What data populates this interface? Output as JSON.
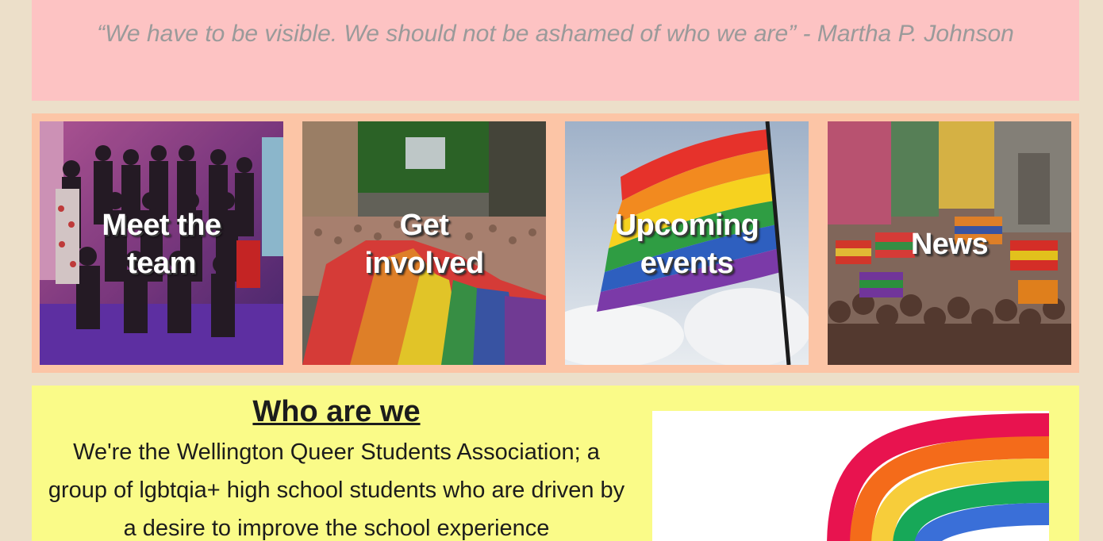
{
  "quote": {
    "text": "“We have to be visible. We should not be ashamed of who we are” - Martha P. Johnson"
  },
  "cards": [
    {
      "label_line1": "Meet the",
      "label_line2": "team"
    },
    {
      "label_line1": "Get",
      "label_line2": "involved"
    },
    {
      "label_line1": "Upcoming",
      "label_line2": "events"
    },
    {
      "label_line1": "News"
    }
  ],
  "about": {
    "title": "Who are we",
    "body": "We're the Wellington Queer Students Association; a group of lgbtqia+ high school students who are driven by a desire to improve the school experience"
  },
  "colors": {
    "page_background": "#ecdfc9",
    "quote_panel": "#fdc3c3",
    "cards_panel": "#fcc5a6",
    "about_panel": "#fafb88",
    "rainbow": [
      "#e8134f",
      "#f46b1a",
      "#f7cd3a",
      "#17a858",
      "#3a6fd8"
    ]
  }
}
